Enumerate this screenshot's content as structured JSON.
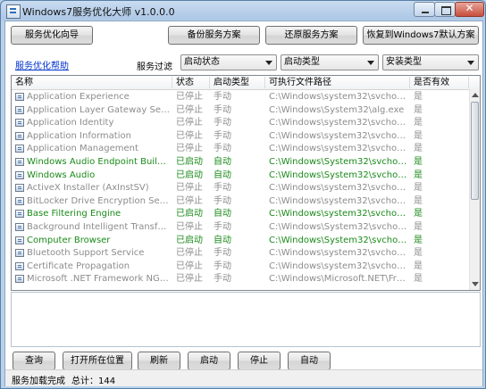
{
  "window": {
    "title": "Windows7服务优化大师 v1.0.0.0",
    "close_glyph": "✕"
  },
  "toolbar": {
    "wizard": "服务优化向导",
    "backup": "备份服务方案",
    "restore": "还原服务方案",
    "default": "恢复到Windows7默认方案"
  },
  "help_link": "服务优化帮助",
  "filter": {
    "label": "服务过滤",
    "start_state": "启动状态",
    "start_type": "启动类型",
    "install_type": "安装类型"
  },
  "columns": [
    "名称",
    "状态",
    "启动类型",
    "可执行文件路径",
    "是否有效"
  ],
  "services": [
    {
      "name": "Application Experience",
      "status": "已停止",
      "type": "手动",
      "path": "C:\\Windows\\system32\\svchost.exe ...",
      "valid": "是",
      "running": false
    },
    {
      "name": "Application Layer Gateway Service",
      "status": "已停止",
      "type": "手动",
      "path": "C:\\Windows\\System32\\alg.exe",
      "valid": "是",
      "running": false
    },
    {
      "name": "Application Identity",
      "status": "已停止",
      "type": "手动",
      "path": "C:\\Windows\\system32\\svchost.exe ...",
      "valid": "是",
      "running": false
    },
    {
      "name": "Application Information",
      "status": "已停止",
      "type": "手动",
      "path": "C:\\Windows\\system32\\svchost.exe ...",
      "valid": "是",
      "running": false
    },
    {
      "name": "Application Management",
      "status": "已停止",
      "type": "手动",
      "path": "C:\\Windows\\system32\\svchost.exe ...",
      "valid": "是",
      "running": false
    },
    {
      "name": "Windows Audio Endpoint Builder",
      "status": "已启动",
      "type": "自动",
      "path": "C:\\Windows\\System32\\svchost.exe ...",
      "valid": "是",
      "running": true
    },
    {
      "name": "Windows Audio",
      "status": "已启动",
      "type": "自动",
      "path": "C:\\Windows\\System32\\svchost.exe ...",
      "valid": "是",
      "running": true
    },
    {
      "name": "ActiveX Installer (AxInstSV)",
      "status": "已停止",
      "type": "手动",
      "path": "C:\\Windows\\system32\\svchost.exe ...",
      "valid": "是",
      "running": false
    },
    {
      "name": "BitLocker Drive Encryption Service",
      "status": "已停止",
      "type": "手动",
      "path": "C:\\Windows\\system32\\svchost.exe ...",
      "valid": "是",
      "running": false
    },
    {
      "name": "Base Filtering Engine",
      "status": "已启动",
      "type": "自动",
      "path": "C:\\Windows\\system32\\svchost.exe ...",
      "valid": "是",
      "running": true
    },
    {
      "name": "Background Intelligent Transfer Service",
      "status": "已停止",
      "type": "手动",
      "path": "C:\\Windows\\System32\\svchost.exe ...",
      "valid": "是",
      "running": false
    },
    {
      "name": "Computer Browser",
      "status": "已启动",
      "type": "自动",
      "path": "C:\\Windows\\System32\\svchost.exe ...",
      "valid": "是",
      "running": true
    },
    {
      "name": "Bluetooth Support Service",
      "status": "已停止",
      "type": "手动",
      "path": "C:\\Windows\\system32\\svchost.exe ...",
      "valid": "是",
      "running": false
    },
    {
      "name": "Certificate Propagation",
      "status": "已停止",
      "type": "手动",
      "path": "C:\\Windows\\system32\\svchost.exe ...",
      "valid": "是",
      "running": false
    },
    {
      "name": "Microsoft .NET Framework NGEN v2....",
      "status": "已停止",
      "type": "手动",
      "path": "C:\\Windows\\Microsoft.NET\\Frame...",
      "valid": "是",
      "running": false
    }
  ],
  "actions": {
    "query": "查询",
    "open_location": "打开所在位置",
    "refresh": "刷新",
    "start": "启动",
    "stop": "停止",
    "auto": "自动"
  },
  "status": {
    "message": "服务加载完成",
    "total": "总计：144"
  },
  "colors": {
    "running": "#1a8a1a",
    "stopped": "#8c8c8c",
    "link": "#0033cc"
  }
}
